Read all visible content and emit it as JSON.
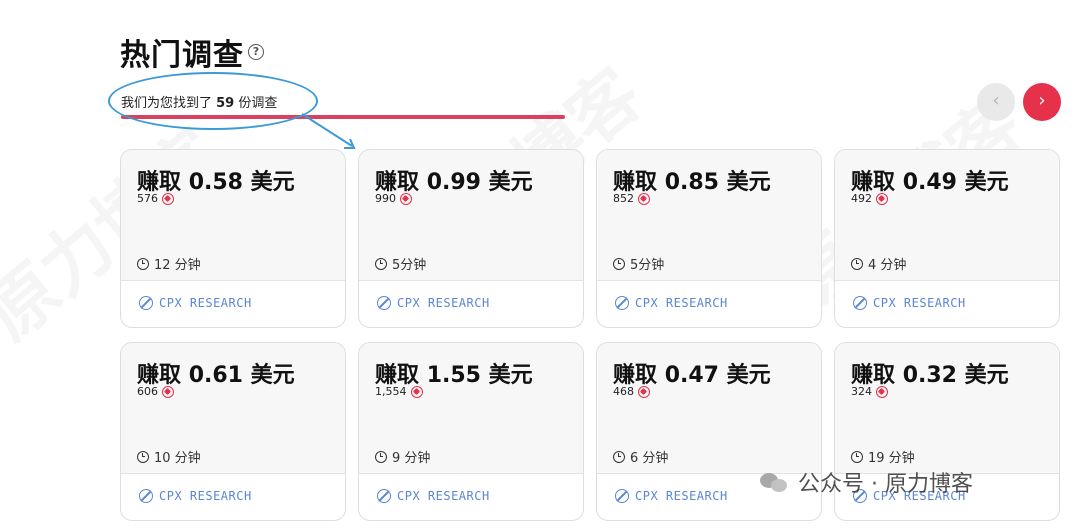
{
  "header": {
    "title": "热门调查",
    "subtitle_prefix": "我们为您找到了 ",
    "survey_count": "59",
    "subtitle_suffix": " 份调查"
  },
  "nav": {
    "prev_label": "‹",
    "next_label": "›"
  },
  "cards": [
    {
      "prefix": "赚取",
      "amount": "0.58",
      "currency": "美元",
      "ratings": "576",
      "duration": "12 分钟",
      "provider": "CPX RESEARCH"
    },
    {
      "prefix": "赚取",
      "amount": "0.99",
      "currency": "美元",
      "ratings": "990",
      "duration": "5分钟",
      "provider": "CPX RESEARCH"
    },
    {
      "prefix": "赚取",
      "amount": "0.85",
      "currency": "美元",
      "ratings": "852",
      "duration": "5分钟",
      "provider": "CPX RESEARCH"
    },
    {
      "prefix": "赚取",
      "amount": "0.49",
      "currency": "美元",
      "ratings": "492",
      "duration": "4 分钟",
      "provider": "CPX RESEARCH"
    },
    {
      "prefix": "赚取",
      "amount": "0.61",
      "currency": "美元",
      "ratings": "606",
      "duration": "10 分钟",
      "provider": "CPX RESEARCH"
    },
    {
      "prefix": "赚取",
      "amount": "1.55",
      "currency": "美元",
      "ratings": "1,554",
      "duration": "9 分钟",
      "provider": "CPX RESEARCH"
    },
    {
      "prefix": "赚取",
      "amount": "0.47",
      "currency": "美元",
      "ratings": "468",
      "duration": "6 分钟",
      "provider": "CPX RESEARCH"
    },
    {
      "prefix": "赚取",
      "amount": "0.32",
      "currency": "美元",
      "ratings": "324",
      "duration": "19 分钟",
      "provider": "CPX RESEARCH"
    }
  ],
  "footer_watermark": "公众号 · 原力博客",
  "colors": {
    "accent_red": "#e6314b",
    "provider_blue": "#5a86d6",
    "annotation_blue": "#3c9ad6"
  }
}
